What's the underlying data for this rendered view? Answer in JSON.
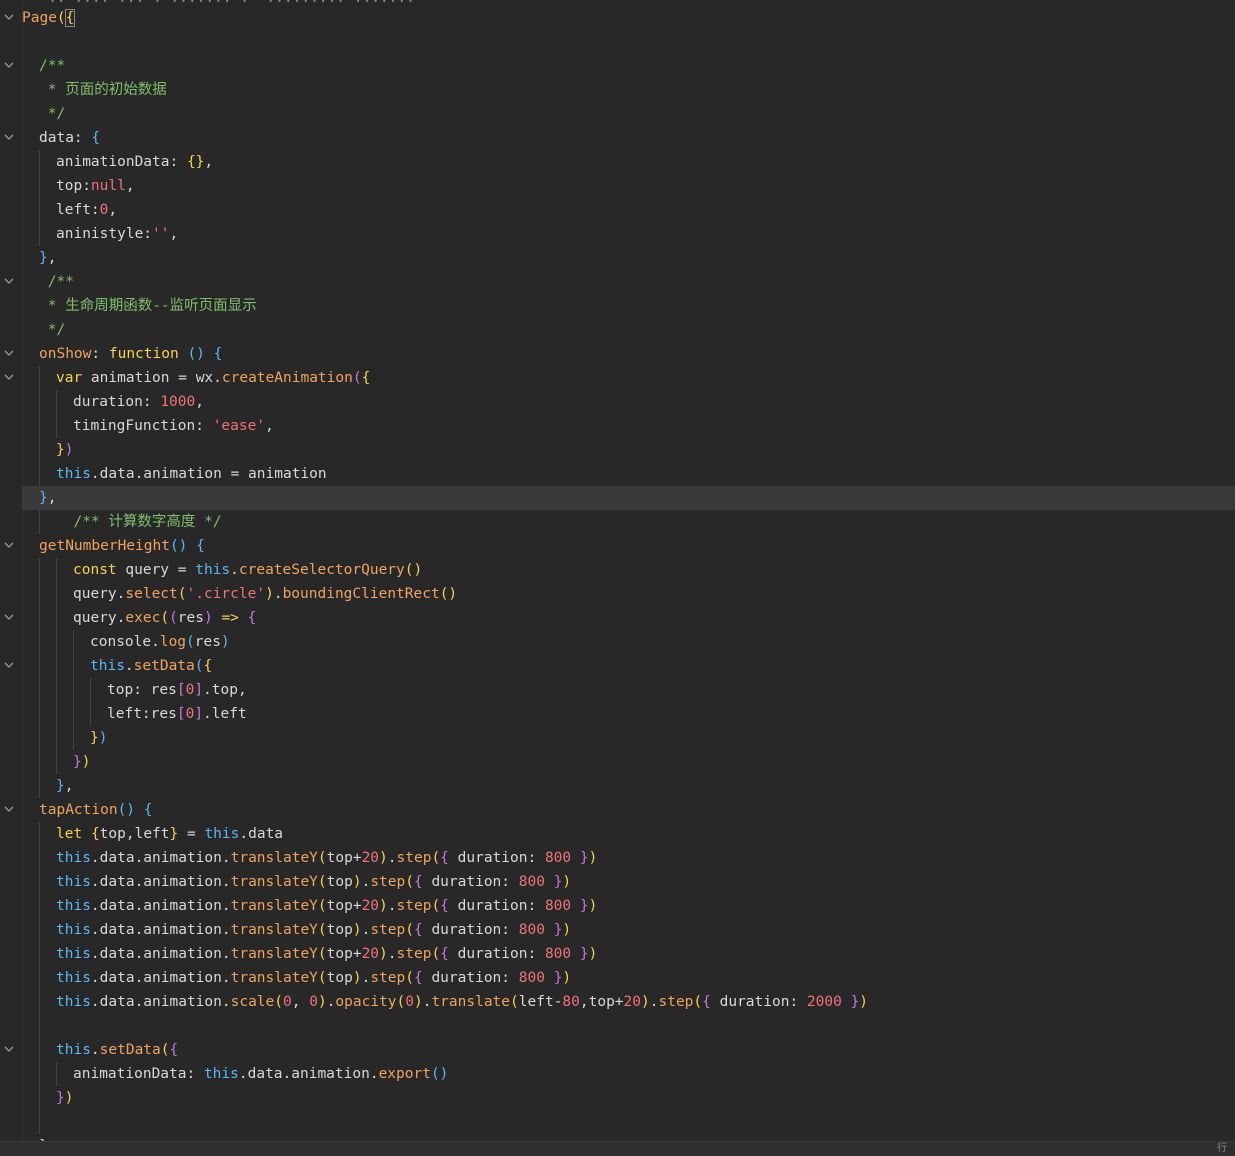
{
  "editor": {
    "status_text": "行",
    "clipped_top_line": "   .. .... ... . ....... .  ......... .......",
    "lines": [
      {
        "indent": 0,
        "fold": true,
        "tokens": [
          [
            "fn",
            "Page"
          ],
          [
            "br",
            "("
          ],
          [
            "cursor",
            "{"
          ]
        ]
      },
      {
        "indent": 0,
        "tokens": []
      },
      {
        "indent": 1,
        "fold": true,
        "tokens": [
          [
            "cm",
            "/**"
          ]
        ]
      },
      {
        "indent": 1,
        "tokens": [
          [
            "cm",
            " * 页面的初始数据"
          ]
        ]
      },
      {
        "indent": 1,
        "tokens": [
          [
            "cm",
            " */"
          ]
        ]
      },
      {
        "indent": 1,
        "fold": true,
        "tokens": [
          [
            "plain",
            "data: "
          ],
          [
            "br3",
            "{"
          ]
        ]
      },
      {
        "indent": 2,
        "tokens": [
          [
            "plain",
            "animationData: "
          ],
          [
            "br",
            "{}"
          ],
          [
            "plain",
            ","
          ]
        ]
      },
      {
        "indent": 2,
        "tokens": [
          [
            "plain",
            "top:"
          ],
          [
            "num",
            "null"
          ],
          [
            "plain",
            ","
          ]
        ]
      },
      {
        "indent": 2,
        "tokens": [
          [
            "plain",
            "left:"
          ],
          [
            "num",
            "0"
          ],
          [
            "plain",
            ","
          ]
        ]
      },
      {
        "indent": 2,
        "tokens": [
          [
            "plain",
            "aninistyle:"
          ],
          [
            "str",
            "''"
          ],
          [
            "plain",
            ","
          ]
        ]
      },
      {
        "indent": 1,
        "tokens": [
          [
            "br3",
            "}"
          ],
          [
            "plain",
            ","
          ]
        ]
      },
      {
        "indent": 1,
        "fold": true,
        "tokens": [
          [
            "cm",
            " /**"
          ]
        ]
      },
      {
        "indent": 1,
        "tokens": [
          [
            "cm",
            " * 生命周期函数--监听页面显示"
          ]
        ]
      },
      {
        "indent": 1,
        "tokens": [
          [
            "cm",
            " */"
          ]
        ]
      },
      {
        "indent": 1,
        "fold": true,
        "tokens": [
          [
            "fn",
            "onShow"
          ],
          [
            "plain",
            ": "
          ],
          [
            "kw",
            "function"
          ],
          [
            "plain",
            " "
          ],
          [
            "br3",
            "()"
          ],
          [
            "plain",
            " "
          ],
          [
            "br3",
            "{"
          ]
        ]
      },
      {
        "indent": 2,
        "fold": true,
        "tokens": [
          [
            "kw",
            "var"
          ],
          [
            "plain",
            " animation = wx."
          ],
          [
            "meth",
            "createAnimation"
          ],
          [
            "br2",
            "("
          ],
          [
            "br",
            "{"
          ]
        ]
      },
      {
        "indent": 3,
        "tokens": [
          [
            "plain",
            "duration: "
          ],
          [
            "num",
            "1000"
          ],
          [
            "plain",
            ","
          ]
        ]
      },
      {
        "indent": 3,
        "tokens": [
          [
            "plain",
            "timingFunction: "
          ],
          [
            "str",
            "'ease'"
          ],
          [
            "plain",
            ","
          ]
        ]
      },
      {
        "indent": 2,
        "tokens": [
          [
            "br",
            "}"
          ],
          [
            "br2",
            ")"
          ]
        ]
      },
      {
        "indent": 2,
        "tokens": [
          [
            "this",
            "this"
          ],
          [
            "plain",
            ".data.animation = animation"
          ]
        ]
      },
      {
        "indent": 1,
        "current": true,
        "tokens": [
          [
            "br3",
            "}"
          ],
          [
            "plain",
            ","
          ]
        ]
      },
      {
        "indent": 2,
        "tokens": [
          [
            "plain",
            "  "
          ],
          [
            "cm",
            "/** 计算数字高度 */"
          ]
        ]
      },
      {
        "indent": 1,
        "fold": true,
        "tokens": [
          [
            "fn",
            "getNumberHeight"
          ],
          [
            "br3",
            "()"
          ],
          [
            "plain",
            " "
          ],
          [
            "br3",
            "{"
          ]
        ]
      },
      {
        "indent": 3,
        "tokens": [
          [
            "kw",
            "const"
          ],
          [
            "plain",
            " query = "
          ],
          [
            "this",
            "this"
          ],
          [
            "plain",
            "."
          ],
          [
            "meth",
            "createSelectorQuery"
          ],
          [
            "br",
            "()"
          ]
        ]
      },
      {
        "indent": 3,
        "tokens": [
          [
            "plain",
            "query."
          ],
          [
            "meth",
            "select"
          ],
          [
            "br",
            "("
          ],
          [
            "str",
            "'.circle'"
          ],
          [
            "br",
            ")"
          ],
          [
            "plain",
            "."
          ],
          [
            "meth",
            "boundingClientRect"
          ],
          [
            "br",
            "()"
          ]
        ]
      },
      {
        "indent": 3,
        "fold": true,
        "tokens": [
          [
            "plain",
            "query."
          ],
          [
            "meth",
            "exec"
          ],
          [
            "br",
            "("
          ],
          [
            "br2",
            "("
          ],
          [
            "plain",
            "res"
          ],
          [
            "br2",
            ")"
          ],
          [
            "plain",
            " "
          ],
          [
            "kw",
            "=>"
          ],
          [
            "plain",
            " "
          ],
          [
            "br2",
            "{"
          ]
        ]
      },
      {
        "indent": 4,
        "tokens": [
          [
            "plain",
            "console."
          ],
          [
            "meth",
            "log"
          ],
          [
            "br3",
            "("
          ],
          [
            "plain",
            "res"
          ],
          [
            "br3",
            ")"
          ]
        ]
      },
      {
        "indent": 4,
        "fold": true,
        "tokens": [
          [
            "this",
            "this"
          ],
          [
            "plain",
            "."
          ],
          [
            "meth",
            "setData"
          ],
          [
            "br3",
            "("
          ],
          [
            "br",
            "{"
          ]
        ]
      },
      {
        "indent": 5,
        "tokens": [
          [
            "plain",
            "top: res"
          ],
          [
            "br2",
            "["
          ],
          [
            "num",
            "0"
          ],
          [
            "br2",
            "]"
          ],
          [
            "plain",
            ".top,"
          ]
        ]
      },
      {
        "indent": 5,
        "tokens": [
          [
            "plain",
            "left:res"
          ],
          [
            "br2",
            "["
          ],
          [
            "num",
            "0"
          ],
          [
            "br2",
            "]"
          ],
          [
            "plain",
            ".left"
          ]
        ]
      },
      {
        "indent": 4,
        "tokens": [
          [
            "br",
            "}"
          ],
          [
            "br3",
            ")"
          ]
        ]
      },
      {
        "indent": 3,
        "tokens": [
          [
            "br2",
            "}"
          ],
          [
            "br",
            ")"
          ]
        ]
      },
      {
        "indent": 2,
        "tokens": [
          [
            "br3",
            "}"
          ],
          [
            "plain",
            ","
          ]
        ]
      },
      {
        "indent": 1,
        "fold": true,
        "tokens": [
          [
            "fn",
            "tapAction"
          ],
          [
            "br3",
            "()"
          ],
          [
            "plain",
            " "
          ],
          [
            "br3",
            "{"
          ]
        ]
      },
      {
        "indent": 2,
        "tokens": [
          [
            "kw",
            "let"
          ],
          [
            "plain",
            " "
          ],
          [
            "br",
            "{"
          ],
          [
            "plain",
            "top,left"
          ],
          [
            "br",
            "}"
          ],
          [
            "plain",
            " = "
          ],
          [
            "this",
            "this"
          ],
          [
            "plain",
            ".data"
          ]
        ]
      },
      {
        "indent": 2,
        "tokens": [
          [
            "this",
            "this"
          ],
          [
            "plain",
            ".data.animation."
          ],
          [
            "meth",
            "translateY"
          ],
          [
            "br",
            "("
          ],
          [
            "plain",
            "top+"
          ],
          [
            "num",
            "20"
          ],
          [
            "br",
            ")"
          ],
          [
            "plain",
            "."
          ],
          [
            "meth",
            "step"
          ],
          [
            "br",
            "("
          ],
          [
            "br2",
            "{"
          ],
          [
            "plain",
            " duration: "
          ],
          [
            "num",
            "800"
          ],
          [
            "plain",
            " "
          ],
          [
            "br2",
            "}"
          ],
          [
            "br",
            ")"
          ]
        ]
      },
      {
        "indent": 2,
        "tokens": [
          [
            "this",
            "this"
          ],
          [
            "plain",
            ".data.animation."
          ],
          [
            "meth",
            "translateY"
          ],
          [
            "br",
            "("
          ],
          [
            "plain",
            "top"
          ],
          [
            "br",
            ")"
          ],
          [
            "plain",
            "."
          ],
          [
            "meth",
            "step"
          ],
          [
            "br",
            "("
          ],
          [
            "br2",
            "{"
          ],
          [
            "plain",
            " duration: "
          ],
          [
            "num",
            "800"
          ],
          [
            "plain",
            " "
          ],
          [
            "br2",
            "}"
          ],
          [
            "br",
            ")"
          ]
        ]
      },
      {
        "indent": 2,
        "tokens": [
          [
            "this",
            "this"
          ],
          [
            "plain",
            ".data.animation."
          ],
          [
            "meth",
            "translateY"
          ],
          [
            "br",
            "("
          ],
          [
            "plain",
            "top+"
          ],
          [
            "num",
            "20"
          ],
          [
            "br",
            ")"
          ],
          [
            "plain",
            "."
          ],
          [
            "meth",
            "step"
          ],
          [
            "br",
            "("
          ],
          [
            "br2",
            "{"
          ],
          [
            "plain",
            " duration: "
          ],
          [
            "num",
            "800"
          ],
          [
            "plain",
            " "
          ],
          [
            "br2",
            "}"
          ],
          [
            "br",
            ")"
          ]
        ]
      },
      {
        "indent": 2,
        "tokens": [
          [
            "this",
            "this"
          ],
          [
            "plain",
            ".data.animation."
          ],
          [
            "meth",
            "translateY"
          ],
          [
            "br",
            "("
          ],
          [
            "plain",
            "top"
          ],
          [
            "br",
            ")"
          ],
          [
            "plain",
            "."
          ],
          [
            "meth",
            "step"
          ],
          [
            "br",
            "("
          ],
          [
            "br2",
            "{"
          ],
          [
            "plain",
            " duration: "
          ],
          [
            "num",
            "800"
          ],
          [
            "plain",
            " "
          ],
          [
            "br2",
            "}"
          ],
          [
            "br",
            ")"
          ]
        ]
      },
      {
        "indent": 2,
        "tokens": [
          [
            "this",
            "this"
          ],
          [
            "plain",
            ".data.animation."
          ],
          [
            "meth",
            "translateY"
          ],
          [
            "br",
            "("
          ],
          [
            "plain",
            "top+"
          ],
          [
            "num",
            "20"
          ],
          [
            "br",
            ")"
          ],
          [
            "plain",
            "."
          ],
          [
            "meth",
            "step"
          ],
          [
            "br",
            "("
          ],
          [
            "br2",
            "{"
          ],
          [
            "plain",
            " duration: "
          ],
          [
            "num",
            "800"
          ],
          [
            "plain",
            " "
          ],
          [
            "br2",
            "}"
          ],
          [
            "br",
            ")"
          ]
        ]
      },
      {
        "indent": 2,
        "tokens": [
          [
            "this",
            "this"
          ],
          [
            "plain",
            ".data.animation."
          ],
          [
            "meth",
            "translateY"
          ],
          [
            "br",
            "("
          ],
          [
            "plain",
            "top"
          ],
          [
            "br",
            ")"
          ],
          [
            "plain",
            "."
          ],
          [
            "meth",
            "step"
          ],
          [
            "br",
            "("
          ],
          [
            "br2",
            "{"
          ],
          [
            "plain",
            " duration: "
          ],
          [
            "num",
            "800"
          ],
          [
            "plain",
            " "
          ],
          [
            "br2",
            "}"
          ],
          [
            "br",
            ")"
          ]
        ]
      },
      {
        "indent": 2,
        "tokens": [
          [
            "this",
            "this"
          ],
          [
            "plain",
            ".data.animation."
          ],
          [
            "meth",
            "scale"
          ],
          [
            "br",
            "("
          ],
          [
            "num",
            "0"
          ],
          [
            "plain",
            ", "
          ],
          [
            "num",
            "0"
          ],
          [
            "br",
            ")"
          ],
          [
            "plain",
            "."
          ],
          [
            "meth",
            "opacity"
          ],
          [
            "br",
            "("
          ],
          [
            "num",
            "0"
          ],
          [
            "br",
            ")"
          ],
          [
            "plain",
            "."
          ],
          [
            "meth",
            "translate"
          ],
          [
            "br",
            "("
          ],
          [
            "plain",
            "left-"
          ],
          [
            "num",
            "80"
          ],
          [
            "plain",
            ",top+"
          ],
          [
            "num",
            "20"
          ],
          [
            "br",
            ")"
          ],
          [
            "plain",
            "."
          ],
          [
            "meth",
            "step"
          ],
          [
            "br",
            "("
          ],
          [
            "br2",
            "{"
          ],
          [
            "plain",
            " duration: "
          ],
          [
            "num",
            "2000"
          ],
          [
            "plain",
            " "
          ],
          [
            "br2",
            "}"
          ],
          [
            "br",
            ")"
          ]
        ]
      },
      {
        "indent": 2,
        "tokens": []
      },
      {
        "indent": 2,
        "fold": true,
        "tokens": [
          [
            "this",
            "this"
          ],
          [
            "plain",
            "."
          ],
          [
            "meth",
            "setData"
          ],
          [
            "br",
            "("
          ],
          [
            "br2",
            "{"
          ]
        ]
      },
      {
        "indent": 3,
        "tokens": [
          [
            "plain",
            "animationData: "
          ],
          [
            "this",
            "this"
          ],
          [
            "plain",
            ".data.animation."
          ],
          [
            "meth",
            "export"
          ],
          [
            "br3",
            "()"
          ]
        ]
      },
      {
        "indent": 2,
        "tokens": [
          [
            "br2",
            "}"
          ],
          [
            "br",
            ")"
          ]
        ]
      },
      {
        "indent": 2,
        "tokens": []
      },
      {
        "indent": 1,
        "tokens": [
          [
            "plain",
            "}"
          ]
        ]
      }
    ]
  },
  "colors": {
    "background": "#282828",
    "current_line": "#3a3a3a",
    "comment": "#7fbf6a",
    "keyword": "#f7d154",
    "this": "#5cb7f2",
    "number": "#f07178",
    "method": "#f0a35e"
  },
  "icons": {
    "fold": "chevron-down-icon"
  }
}
